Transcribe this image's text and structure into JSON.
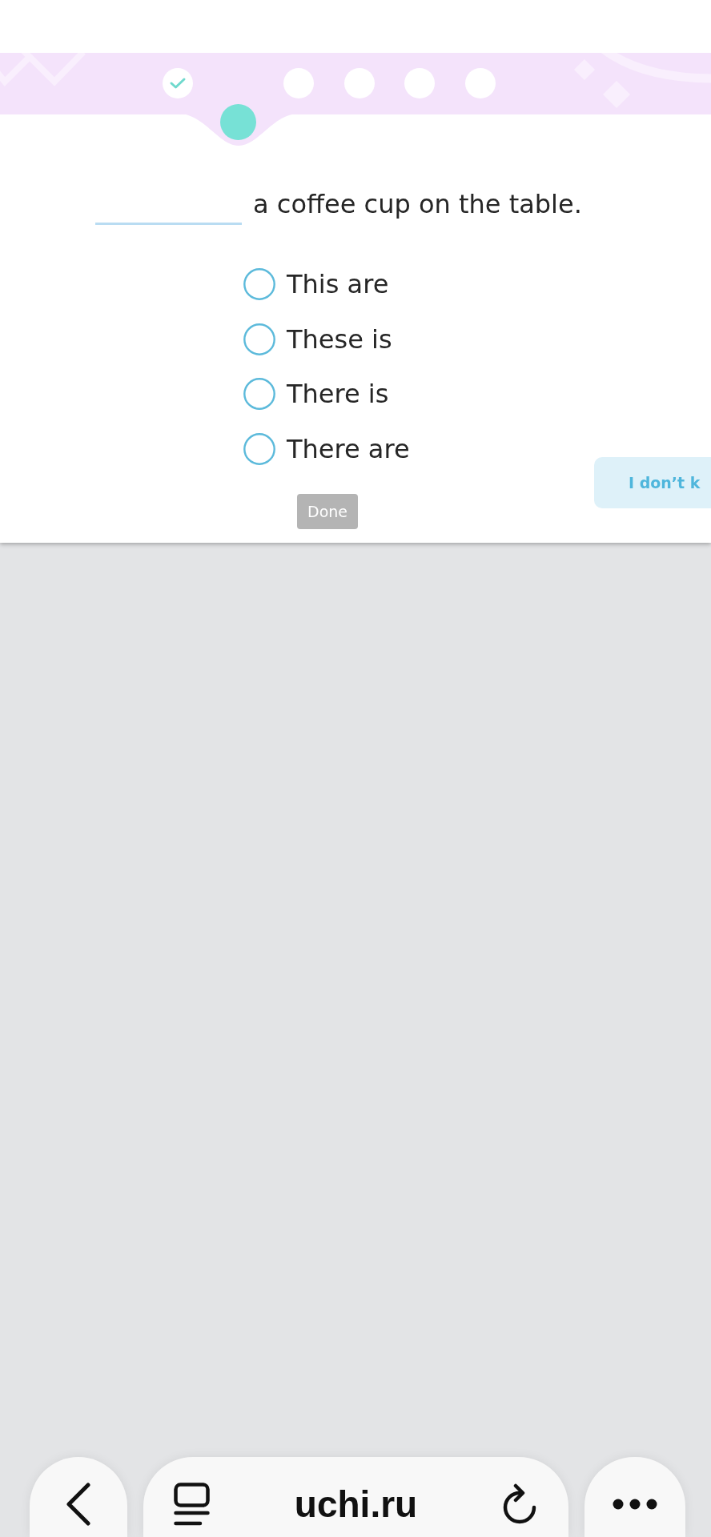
{
  "header": {
    "steps": [
      {
        "completed": true,
        "current": false
      },
      {
        "completed": false,
        "current": true
      },
      {
        "completed": false,
        "current": false
      },
      {
        "completed": false,
        "current": false
      },
      {
        "completed": false,
        "current": false
      },
      {
        "completed": false,
        "current": false
      }
    ]
  },
  "question": {
    "text_after_blank": "a coffee cup on the table."
  },
  "options": [
    {
      "label": "This are",
      "selected": false
    },
    {
      "label": "These is",
      "selected": false
    },
    {
      "label": "There is",
      "selected": false
    },
    {
      "label": "There are",
      "selected": false
    }
  ],
  "done_button": {
    "label": "Done",
    "disabled": true
  },
  "dont_know_button": {
    "label": "I don’t k"
  },
  "browser_bar": {
    "url": "uchi.ru"
  }
}
